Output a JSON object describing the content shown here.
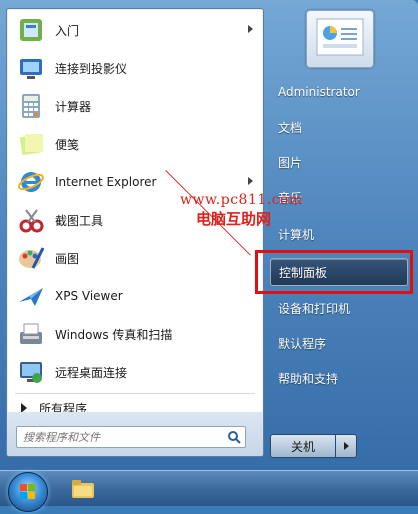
{
  "left_pane": {
    "programs": [
      {
        "label": "入门",
        "icon": "getting-started-icon",
        "has_arrow": true
      },
      {
        "label": "连接到投影仪",
        "icon": "projector-icon",
        "has_arrow": false
      },
      {
        "label": "计算器",
        "icon": "calculator-icon",
        "has_arrow": false
      },
      {
        "label": "便笺",
        "icon": "sticky-notes-icon",
        "has_arrow": false
      },
      {
        "label": "Internet Explorer",
        "icon": "internet-explorer-icon",
        "has_arrow": true
      },
      {
        "label": "截图工具",
        "icon": "snipping-tool-icon",
        "has_arrow": false
      },
      {
        "label": "画图",
        "icon": "paint-icon",
        "has_arrow": false
      },
      {
        "label": "XPS Viewer",
        "icon": "xps-viewer-icon",
        "has_arrow": false
      },
      {
        "label": "Windows 传真和扫描",
        "icon": "fax-scan-icon",
        "has_arrow": false
      },
      {
        "label": "远程桌面连接",
        "icon": "remote-desktop-icon",
        "has_arrow": false
      }
    ],
    "all_programs": "所有程序",
    "search_placeholder": "搜索程序和文件"
  },
  "right_pane": {
    "items": [
      {
        "label": "Administrator"
      },
      {
        "label": "文档"
      },
      {
        "label": "图片"
      },
      {
        "label": "音乐"
      },
      {
        "label": "计算机"
      },
      {
        "label": "控制面板"
      },
      {
        "label": "设备和打印机"
      },
      {
        "label": "默认程序"
      },
      {
        "label": "帮助和支持"
      }
    ],
    "highlighted": "控制面板"
  },
  "shutdown": {
    "label": "关机"
  },
  "watermark": {
    "url": "www.pc811.com",
    "site": "电脑互助网"
  },
  "colors": {
    "highlight_box": "#e01010",
    "watermark": "#e0201a"
  }
}
